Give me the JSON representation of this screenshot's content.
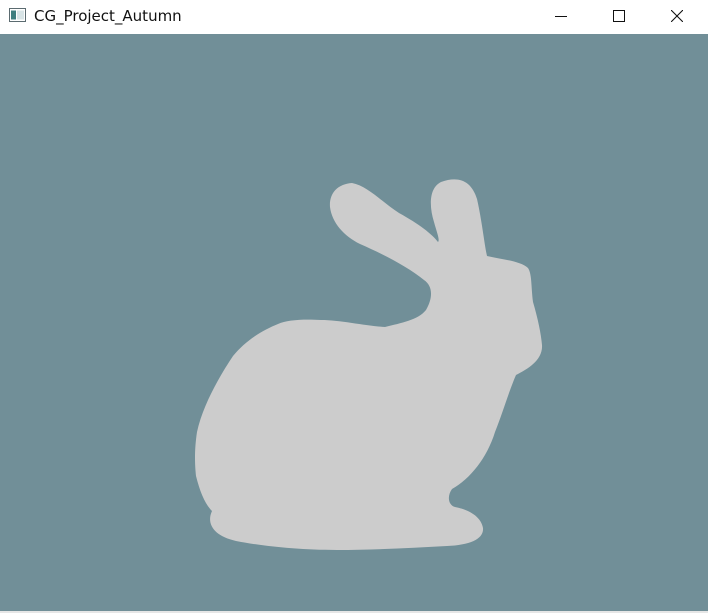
{
  "window": {
    "title": "CG_Project_Autumn",
    "icon": "app-window-icon",
    "controls": [
      {
        "name": "minimize-button",
        "icon": "minimize-icon"
      },
      {
        "name": "maximize-button",
        "icon": "maximize-icon"
      },
      {
        "name": "close-button",
        "icon": "close-icon"
      }
    ]
  },
  "scene": {
    "background_color": "#718f98",
    "model_color": "#cccccc",
    "model": "bunny-silhouette"
  }
}
